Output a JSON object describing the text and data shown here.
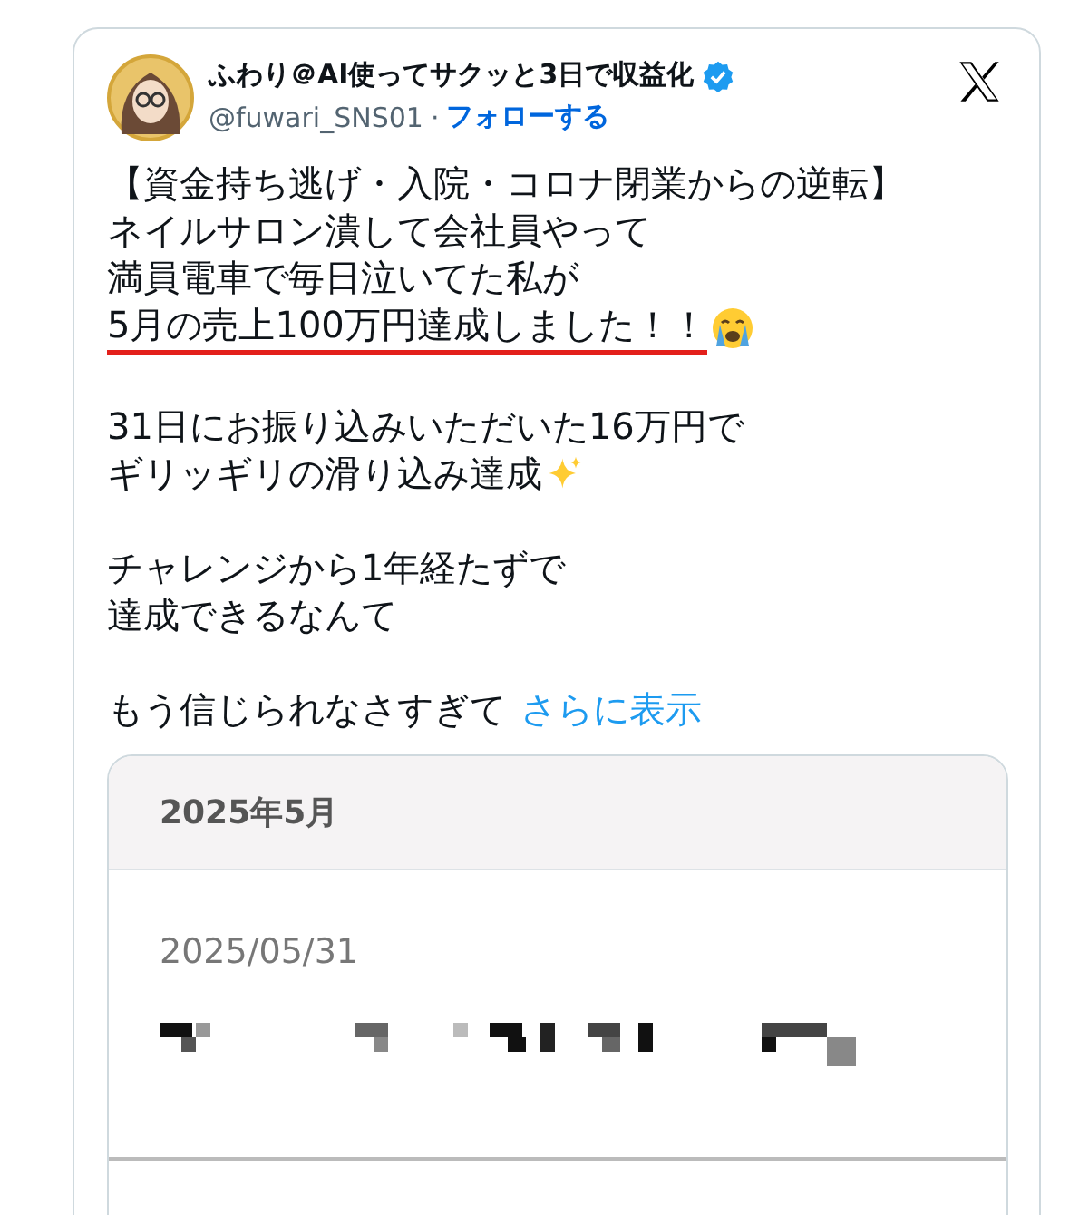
{
  "author": {
    "name": "ふわり＠AI使ってサクッと3日で収益化",
    "verified": true,
    "handle": "@fuwari_SNS01",
    "separator": "·",
    "follow": "フォローする"
  },
  "body": [
    {
      "lines": [
        {
          "text": "【資金持ち逃げ・入院・コロナ閉業からの逆転】",
          "underlined": false
        },
        {
          "text": "ネイルサロン潰して会社員やって",
          "underlined": false
        },
        {
          "text": "満員電車で毎日泣いてた私が",
          "underlined": false
        },
        {
          "text": "5月の売上100万円達成しました！！",
          "underlined": true,
          "kind": "tearful"
        }
      ]
    },
    {
      "lines": [
        {
          "text": "31日にお振り込みいただいた16万円で",
          "underlined": false
        },
        {
          "text": "ギリッギリの滑り込み達成",
          "underlined": false,
          "kind": "sparkly"
        }
      ]
    },
    {
      "lines": [
        {
          "text": "チャレンジから1年経たずで",
          "underlined": false
        },
        {
          "text": "達成できるなんて",
          "underlined": false
        }
      ]
    }
  ],
  "last_line": {
    "text": "もう信じられなさすぎて",
    "more": "さらに表示"
  },
  "media": {
    "header": "2025年5月",
    "date": "2025/05/31"
  }
}
